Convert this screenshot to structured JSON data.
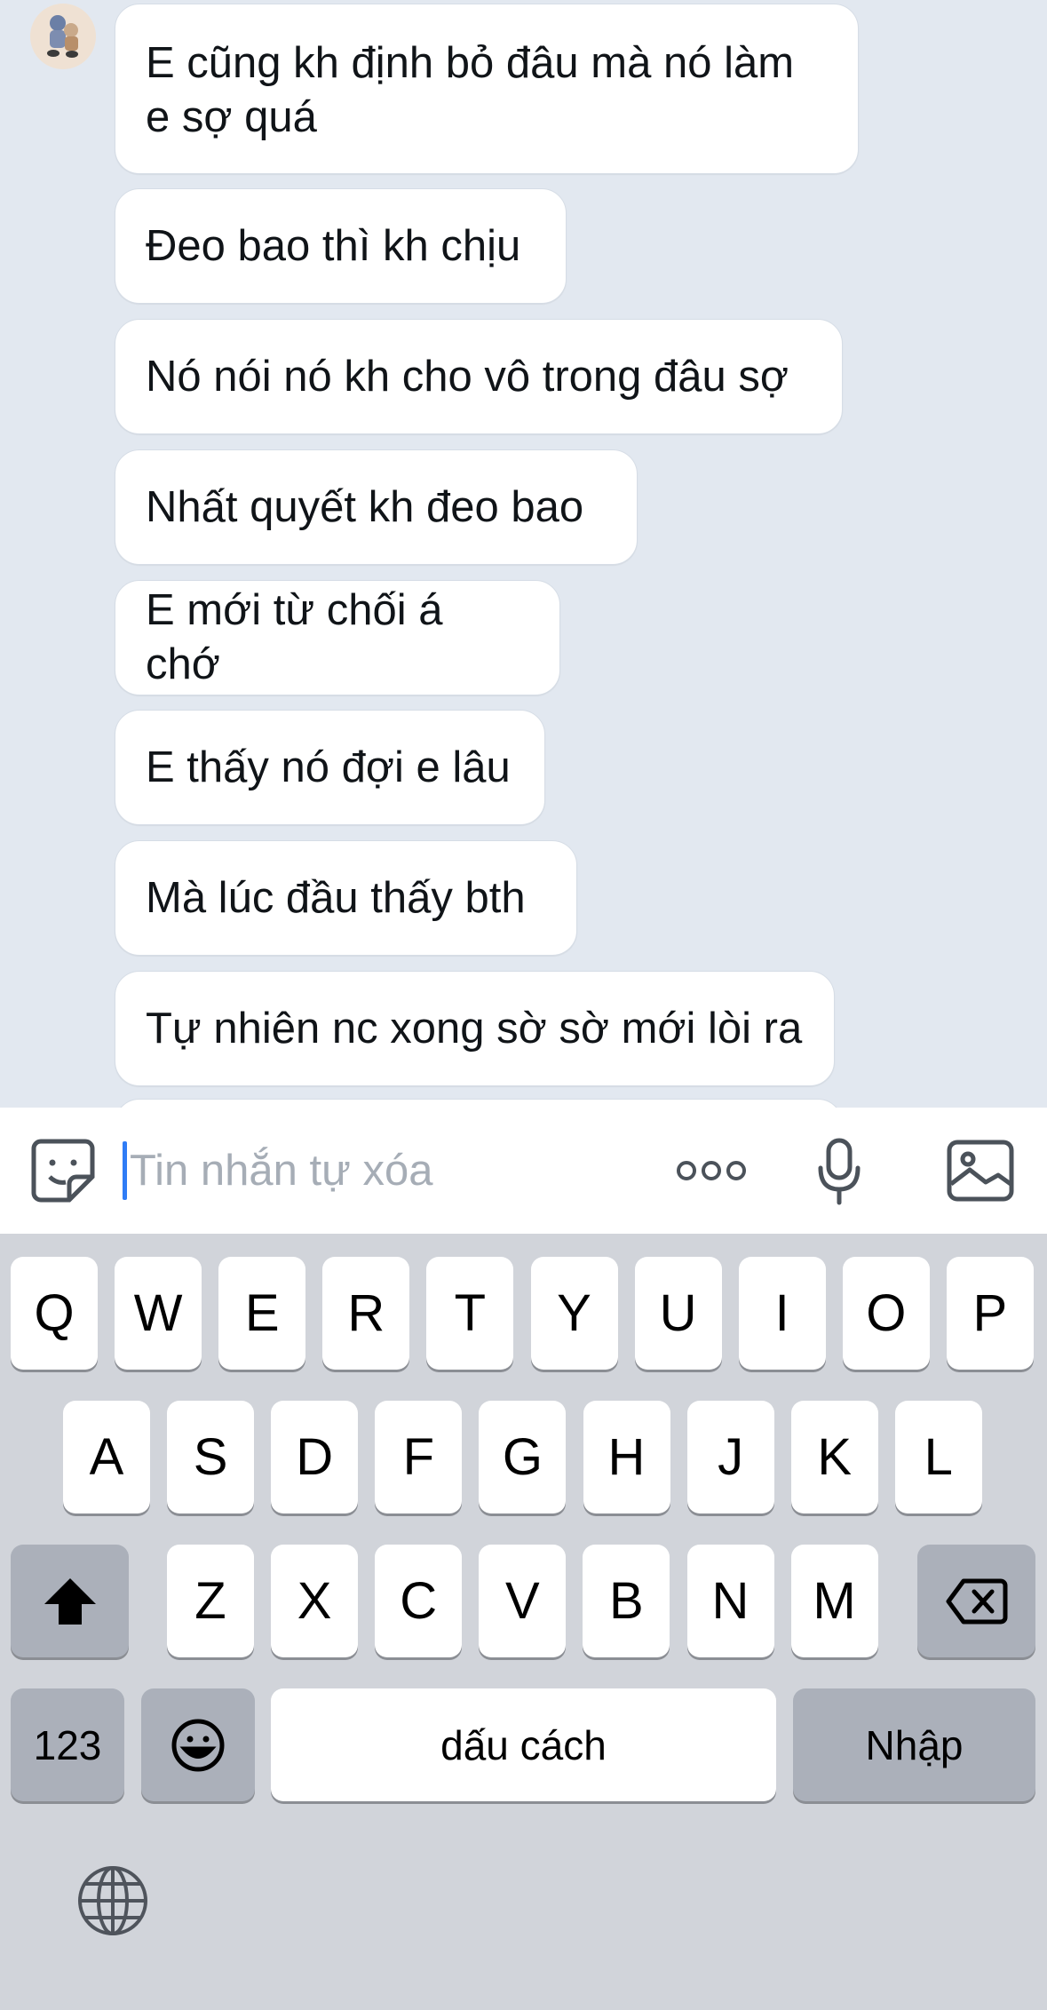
{
  "chat": {
    "messages": [
      {
        "line1": "E cũng kh định bỏ đâu mà nó làm",
        "line2": "e sợ quá"
      },
      {
        "text": "Đeo bao thì kh chịu"
      },
      {
        "text": "Nó nói nó kh cho vô trong đâu sợ"
      },
      {
        "text": "Nhất quyết kh đeo bao"
      },
      {
        "text": "E mới từ chối á chớ"
      },
      {
        "text": "E thấy nó đợi e lâu"
      },
      {
        "text": "Mà lúc đầu thấy bth"
      },
      {
        "text": "Tự nhiên nc xong sờ sờ mới lòi ra"
      }
    ]
  },
  "input": {
    "placeholder": "Tin nhắn tự xóa",
    "icons": [
      "sticker-icon",
      "more-icon",
      "microphone-icon",
      "image-icon"
    ]
  },
  "keyboard": {
    "row1": [
      "Q",
      "W",
      "E",
      "R",
      "T",
      "Y",
      "U",
      "I",
      "O",
      "P"
    ],
    "row2": [
      "A",
      "S",
      "D",
      "F",
      "G",
      "H",
      "J",
      "K",
      "L"
    ],
    "row3": [
      "Z",
      "X",
      "C",
      "V",
      "B",
      "N",
      "M"
    ],
    "numbers_label": "123",
    "space_label": "dấu cách",
    "return_label": "Nhập",
    "icons": [
      "shift-icon",
      "backspace-icon",
      "emoji-icon",
      "globe-icon"
    ]
  },
  "colors": {
    "chat_bg": "#e2e8f0",
    "bubble_bg": "#ffffff",
    "caret": "#2f7cf6",
    "keyboard_bg": "#d1d4da"
  }
}
